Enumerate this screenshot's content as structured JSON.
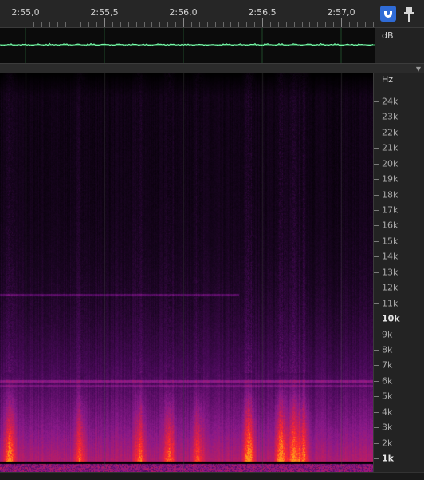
{
  "ruler": {
    "labels": [
      "2:55,0",
      "2:55,5",
      "2:56,0",
      "2:56,5",
      "2:57,0"
    ]
  },
  "toolbar": {
    "snap_icon": "magnet-icon",
    "pin_icon": "pin-icon",
    "accent_color": "#2f6bd6"
  },
  "waveform": {
    "unit": "dB",
    "color": "#3fbf6a"
  },
  "spectrogram": {
    "unit": "Hz",
    "frequency_labels": [
      "24k",
      "23k",
      "22k",
      "21k",
      "20k",
      "19k",
      "18k",
      "17k",
      "16k",
      "15k",
      "14k",
      "13k",
      "12k",
      "11k",
      "10k",
      "9k",
      "8k",
      "7k",
      "6k",
      "5k",
      "4k",
      "3k",
      "2k",
      "1k"
    ],
    "highlighted_labels": [
      "10k",
      "1k"
    ],
    "palette": [
      "#000000",
      "#1a0522",
      "#4a0a5a",
      "#8a1a8a",
      "#c81e5a",
      "#ff2a2a",
      "#ff9a1a"
    ]
  }
}
